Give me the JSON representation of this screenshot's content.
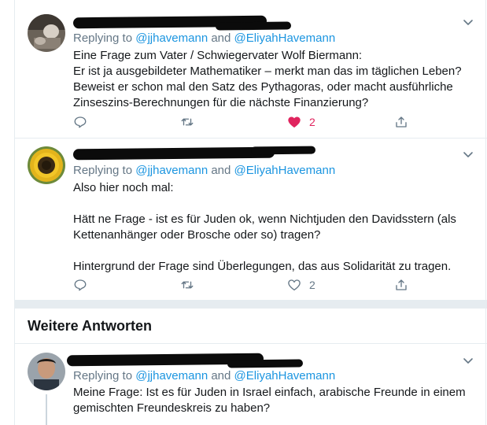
{
  "section_header": {
    "title": "Weitere Antworten"
  },
  "tweets": [
    {
      "replying_prefix": "Replying to ",
      "handle_1": "@jjhavemann",
      "conjunction": " and ",
      "handle_2": "@EliyahHavemann",
      "text": "Eine Frage zum Vater / Schwiegervater Wolf Biermann:\nEr ist ja ausgebildeter Mathematiker – merkt man das im täglichen Leben? Beweist er schon mal den Satz des Pythagoras, oder macht ausführliche Zinseszins-Berechnungen für die nächste Finanzierung?",
      "like_count": "2",
      "liked": true
    },
    {
      "replying_prefix": "Replying to ",
      "handle_1": "@jjhavemann",
      "conjunction": " and ",
      "handle_2": "@EliyahHavemann",
      "text": "Also hier noch mal:\n\nHätt ne Frage - ist es für Juden ok, wenn Nichtjuden den Davidsstern (als Kettenanhänger oder Brosche oder so) tragen?\n\nHintergrund der Frage sind Überlegungen, das aus Solidarität zu tragen.",
      "like_count": "2",
      "liked": false
    },
    {
      "replying_prefix": "Replying to ",
      "handle_1": "@jjhavemann",
      "conjunction": " and ",
      "handle_2": "@EliyahHavemann",
      "text": "Meine Frage: Ist es für Juden in Israel einfach, arabische Freunde in einem gemischten Freundeskreis zu haben?"
    }
  ],
  "colors": {
    "accent": "#1b95e0",
    "muted": "#657786",
    "like": "#e0245e",
    "border": "#e6ecf0"
  },
  "icons": [
    "reply-icon",
    "retweet-icon",
    "like-icon",
    "share-icon",
    "chevron-down-icon"
  ]
}
